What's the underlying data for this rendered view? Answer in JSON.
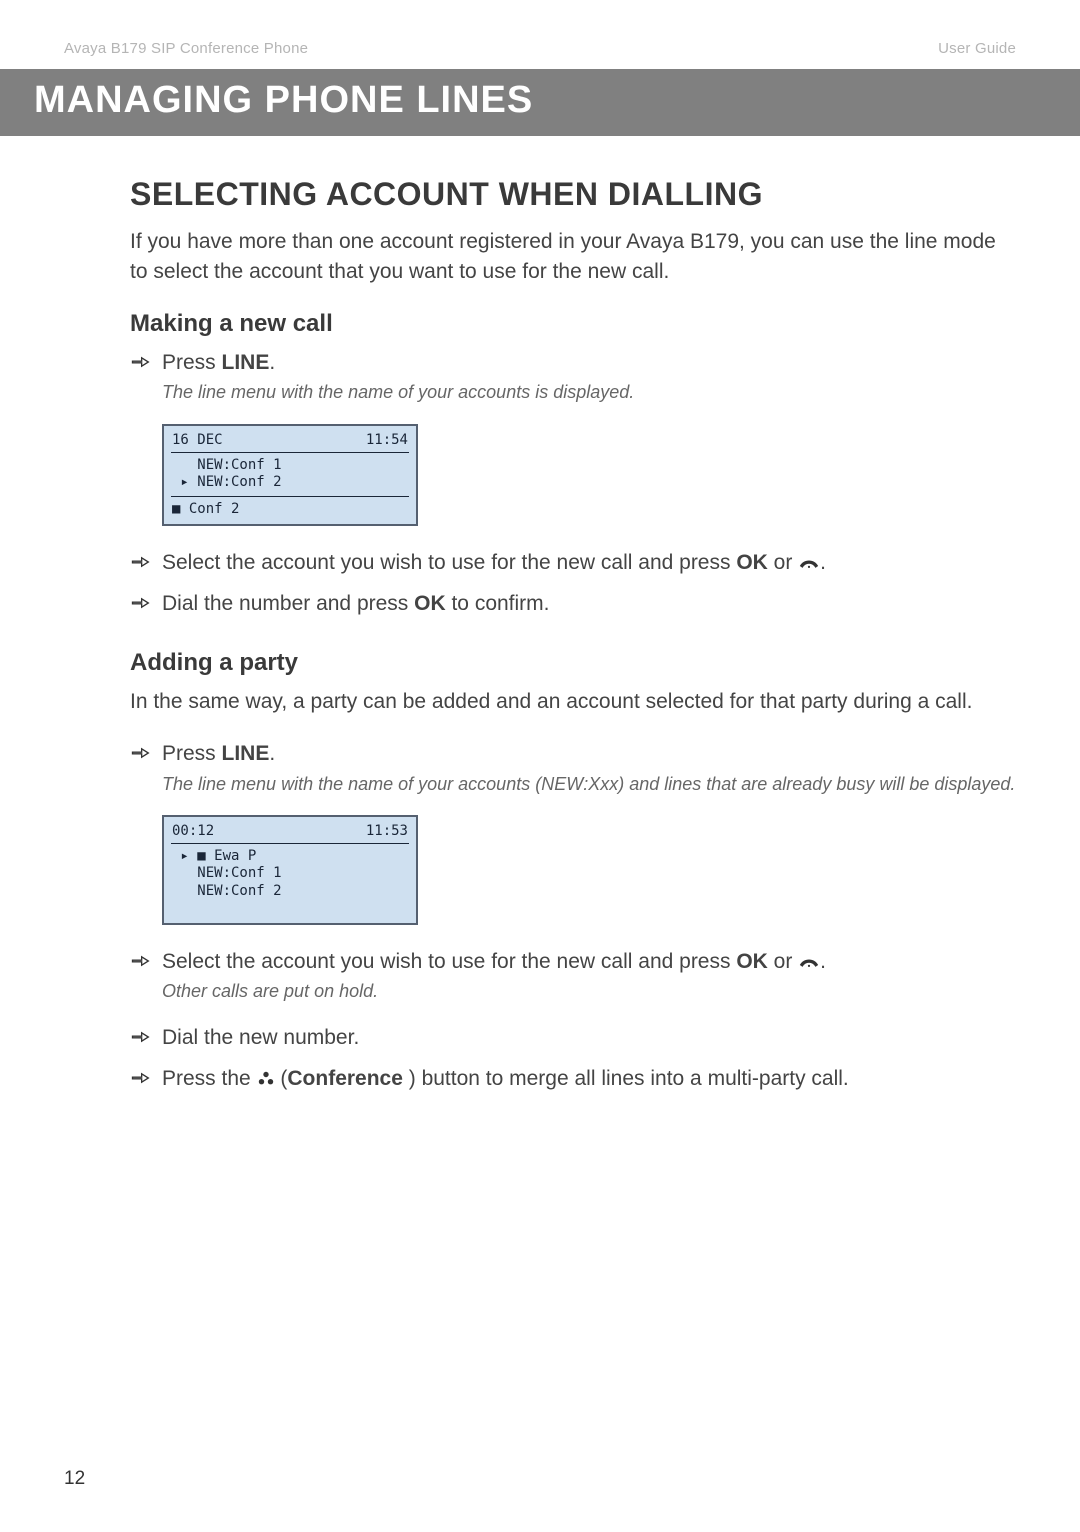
{
  "header": {
    "left": "Avaya B179 SIP Conference Phone",
    "right": "User Guide"
  },
  "band": "MANAGING PHONE LINES",
  "section1": {
    "title": "SELECTING ACCOUNT WHEN DIALLING",
    "intro": "If you have more than one account registered in your Avaya B179, you can use the line mode to select the account that you want to use for the new call."
  },
  "making": {
    "title": "Making a new call",
    "step1_pre": "Press ",
    "step1_bold": "LINE",
    "step1_post": ".",
    "note1": "The line menu with the name of your accounts is displayed.",
    "lcd_top_left": "16 DEC",
    "lcd_top_right": "11:54",
    "lcd_body1": "   NEW:Conf 1",
    "lcd_body2": " ▸ NEW:Conf 2",
    "lcd_foot": "■ Conf 2",
    "step2_pre": "Select the account you wish to use for the new call and press ",
    "step2_bold": "OK",
    "step2_post": " or ",
    "step2_end": ".",
    "step3_pre": "Dial the number and press ",
    "step3_bold": "OK",
    "step3_post": " to confirm."
  },
  "adding": {
    "title": "Adding a party",
    "intro": "In the same way, a party can be added and an account selected for that party during a call.",
    "step1_pre": "Press ",
    "step1_bold": "LINE",
    "step1_post": ".",
    "note1": "The line menu with the name of your accounts (NEW:Xxx) and lines that are already busy will be displayed.",
    "lcd_top_left": "00:12",
    "lcd_top_right": "11:53",
    "lcd_body1": " ▸ ■ Ewa P",
    "lcd_body2": "   NEW:Conf 1",
    "lcd_body3": "   NEW:Conf 2",
    "step2_pre": "Select the account you wish to use for the new call and press ",
    "step2_bold": "OK",
    "step2_post": " or ",
    "step2_end": ".",
    "note2": "Other calls are put on hold.",
    "step3": "Dial the new number.",
    "step4_pre": "Press the ",
    "step4_mid": " (",
    "step4_bold": "Conference",
    "step4_post": " ) button to merge all lines into a multi-party call."
  },
  "page": "12"
}
